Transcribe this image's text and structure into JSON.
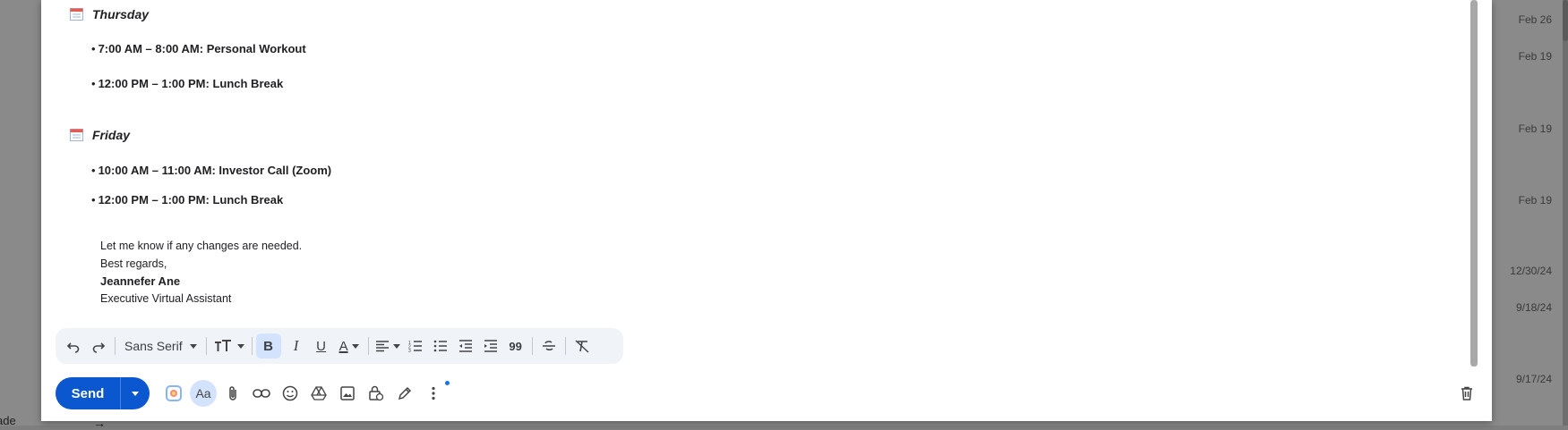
{
  "days": [
    {
      "title": "Thursday",
      "events": [
        "7:00 AM – 8:00 AM: Personal Workout",
        "12:00 PM – 1:00 PM: Lunch Break"
      ]
    },
    {
      "title": "Friday",
      "events": [
        "10:00 AM – 11:00 AM: Investor Call (Zoom)",
        "12:00 PM – 1:00 PM: Lunch Break"
      ]
    }
  ],
  "signature": {
    "line1": "Let me know if any changes are needed.",
    "line2": "Best regards,",
    "name": "Jeannefer Ane",
    "title": "Executive Virtual Assistant"
  },
  "toolbar": {
    "font": "Sans Serif",
    "bold_label": "B",
    "italic_label": "I",
    "underline_label": "U",
    "text_color_label": "A",
    "quote_label": "99"
  },
  "compose": {
    "send_label": "Send",
    "aa_label": "Aa"
  },
  "background": {
    "dates": [
      "Feb 26",
      "Feb 19",
      "Feb 19",
      "Feb 19",
      "12/30/24",
      "9/18/24",
      "9/17/24"
    ],
    "left_text": "ade",
    "arrow": "→"
  },
  "icons": {
    "calendar": "calendar-icon",
    "undo": "undo-icon",
    "redo": "redo-icon",
    "attach": "paperclip-icon",
    "link": "link-icon",
    "emoji": "emoji-icon",
    "drive": "drive-icon",
    "photo": "photo-icon",
    "confidential": "lock-clock-icon",
    "signature": "pen-icon",
    "more": "more-vert-icon",
    "trash": "trash-icon"
  },
  "colors": {
    "send": "#0b57d0",
    "toolbar_bg": "#f0f4f9",
    "active": "#d3e3fd"
  }
}
